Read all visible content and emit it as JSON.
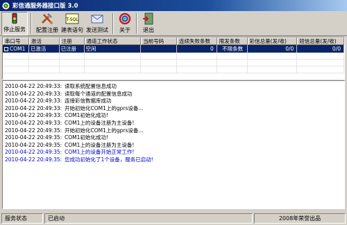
{
  "window": {
    "title": "彩信通服务器接口版 3.0",
    "app_icon": "app-icon"
  },
  "toolbar": {
    "buttons": [
      {
        "label": "停止服务",
        "icon": "stop-traffic-light-icon"
      },
      {
        "label": "配置注册",
        "icon": "tools-icon"
      },
      {
        "label": "建表语句",
        "icon": "t-sql-icon"
      },
      {
        "label": "发送测试",
        "icon": "send-test-icon"
      },
      {
        "label": "关于",
        "icon": "about-icon"
      },
      {
        "label": "退出",
        "icon": "exit-icon"
      }
    ]
  },
  "grid": {
    "columns": [
      "串口号",
      "激活",
      "注册",
      "通道工作状态",
      "当前号码",
      "连续失败条数",
      "限发条数",
      "彩信总量(发/收)",
      "短信总量(发/收)"
    ],
    "rows": [
      {
        "port": "COM1",
        "activated": "已激活",
        "registered": "已注册",
        "status": "空闲",
        "current_number": "",
        "consecutive_failures": "0",
        "send_limit": "不限条数",
        "mms_total": "0/0",
        "sms_total": "0/0"
      }
    ]
  },
  "log": [
    {
      "time": "2010-04-22 20:49:33:",
      "text": "读取系统配置信息成功",
      "highlight": false
    },
    {
      "time": "2010-04-22 20:49:33:",
      "text": "读取每个通道的配置信息成功",
      "highlight": false
    },
    {
      "time": "2010-04-22 20:49:33:",
      "text": "连接彩信数据库成功",
      "highlight": false
    },
    {
      "time": "2010-04-22 20:49:33:",
      "text": "开始初始化COM1上的gprs设备...",
      "highlight": false
    },
    {
      "time": "2010-04-22 20:49:33:",
      "text": "COM1初始化成功!",
      "highlight": false
    },
    {
      "time": "2010-04-22 20:49:33:",
      "text": "COM1上的设备注册为主设备!",
      "highlight": false
    },
    {
      "time": "2010-04-22 20:49:35:",
      "text": "开始初始化COM1上的gprs设备...",
      "highlight": false
    },
    {
      "time": "2010-04-22 20:49:35:",
      "text": "COM1初始化成功!",
      "highlight": false
    },
    {
      "time": "2010-04-22 20:49:35:",
      "text": "COM1上的设备注册为主设备!",
      "highlight": false
    },
    {
      "time": "2010-04-22 20:49:35:",
      "text": "COM1上的设备开始正常工作!",
      "highlight": true
    },
    {
      "time": "2010-04-22 20:49:35:",
      "text": "您成功初始化了1个设备，服务已启动!",
      "highlight": true
    }
  ],
  "status": {
    "label": "服务状态",
    "value": "已启动",
    "copyright": "2008年荣誉出品"
  },
  "colors": {
    "selection": "#0a246a",
    "log_highlight": "#0000cc",
    "face": "#d4d0c8"
  }
}
